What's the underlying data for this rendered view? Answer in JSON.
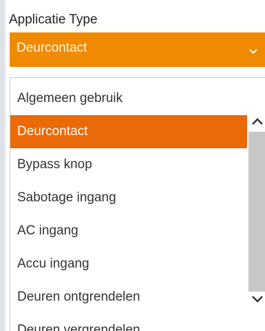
{
  "field": {
    "label": "Applicatie Type",
    "selected_value": "Deurcontact"
  },
  "dropdown": {
    "options": [
      {
        "label": "Algemeen gebruik"
      },
      {
        "label": "Deurcontact"
      },
      {
        "label": "Bypass knop"
      },
      {
        "label": "Sabotage ingang"
      },
      {
        "label": "AC ingang"
      },
      {
        "label": "Accu ingang"
      },
      {
        "label": "Deuren ontgrendelen"
      },
      {
        "label": "Deuren vergrendelen"
      }
    ],
    "selected_index": 1
  },
  "icons": {
    "select_chevron": "chevron-down-icon",
    "scroll_up": "chevron-up-icon",
    "scroll_down": "chevron-down-icon"
  },
  "colors": {
    "select_background": "#f08a00",
    "selected_option": "#ea6a08",
    "scrollbar_thumb": "#c8c8c8"
  }
}
